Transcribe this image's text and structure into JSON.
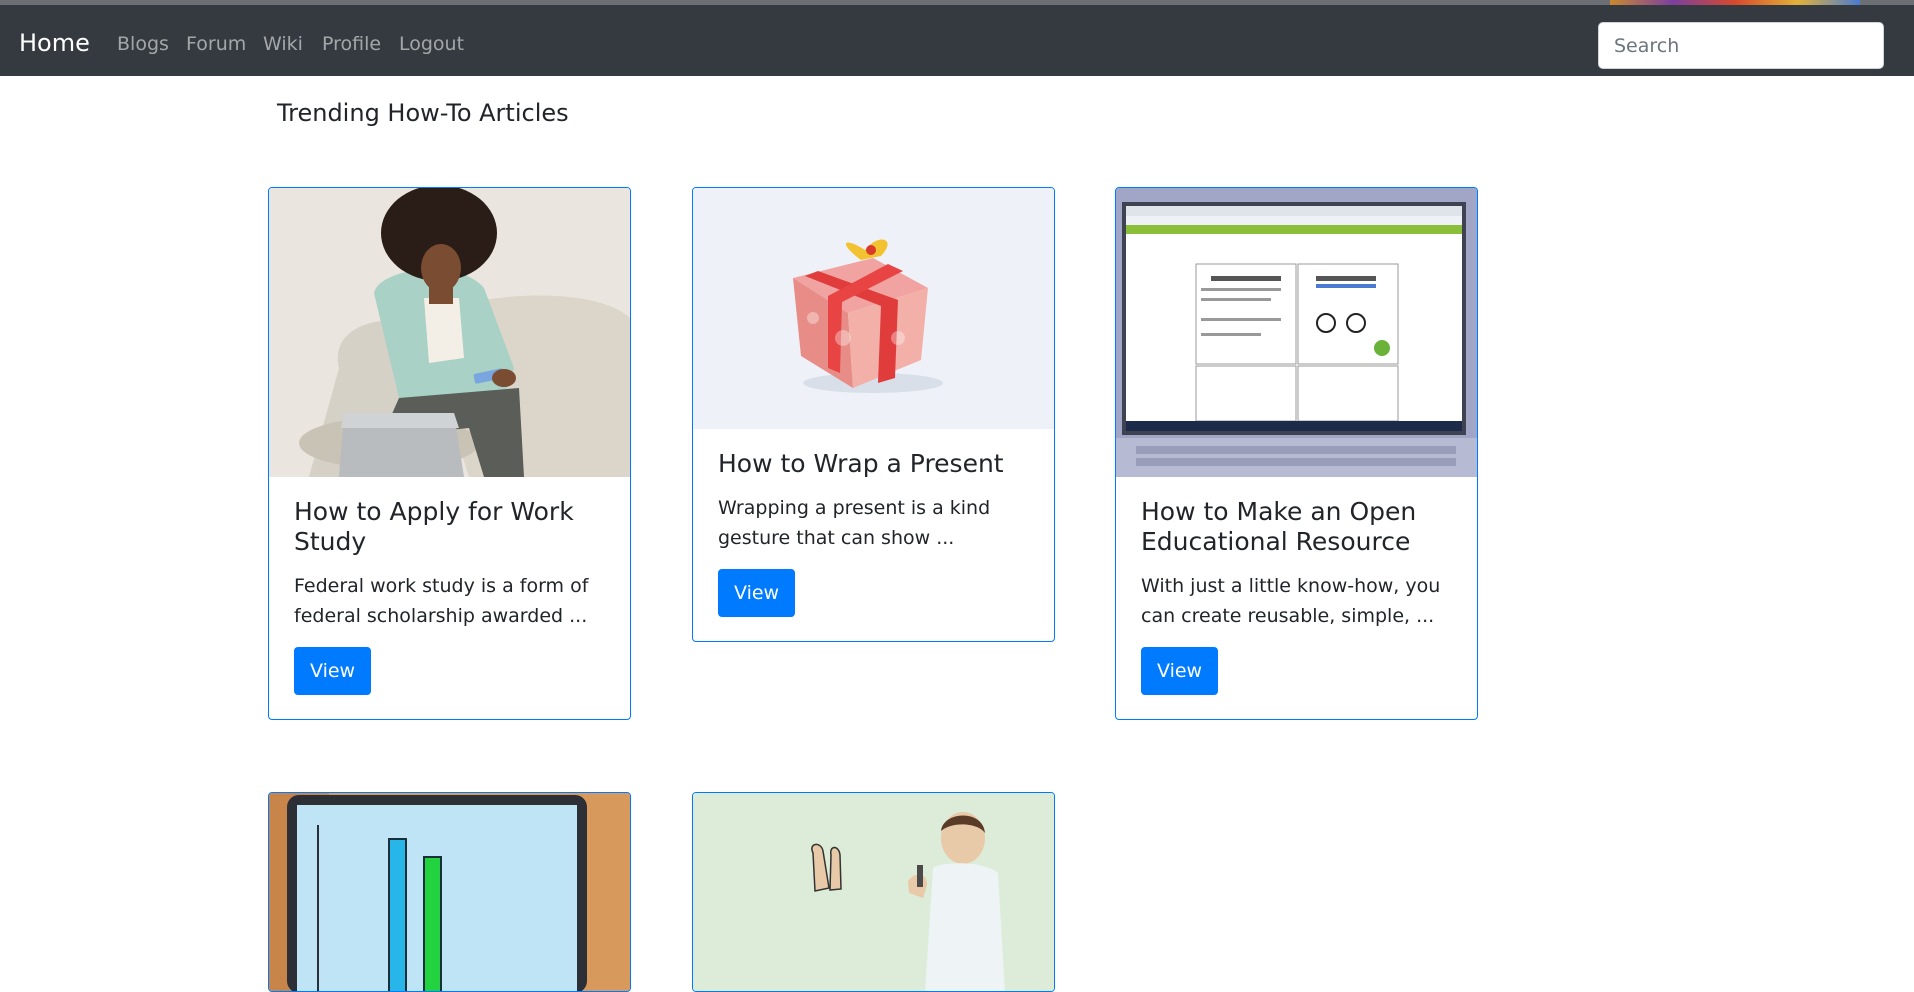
{
  "navbar": {
    "brand": "Home",
    "links": [
      "Blogs",
      "Forum",
      "Wiki",
      "Profile",
      "Logout"
    ],
    "search_placeholder": "Search",
    "bg_color": "#343a40"
  },
  "page": {
    "title": "Trending How-To Articles",
    "accent_color": "#007bff"
  },
  "cards": [
    {
      "title": "How to Apply for Work Study",
      "excerpt": "Federal work study is a form of federal scholarship awarded ...",
      "button_label": "View",
      "image_icon": "person-laptop-illustration"
    },
    {
      "title": "How to Wrap a Present",
      "excerpt": "Wrapping a present is a kind gesture that can show ...",
      "button_label": "View",
      "image_icon": "gift-box-photo"
    },
    {
      "title": "How to Make an Open Educational Resource",
      "excerpt": "With just a little know-how, you can create reusable, simple, ...",
      "button_label": "View",
      "image_icon": "laptop-screenshot-illustration"
    },
    {
      "title": "",
      "excerpt": "",
      "button_label": "",
      "image_icon": "laptop-bar-chart-illustration"
    },
    {
      "title": "",
      "excerpt": "",
      "button_label": "",
      "image_icon": "man-waving-illustration"
    }
  ]
}
